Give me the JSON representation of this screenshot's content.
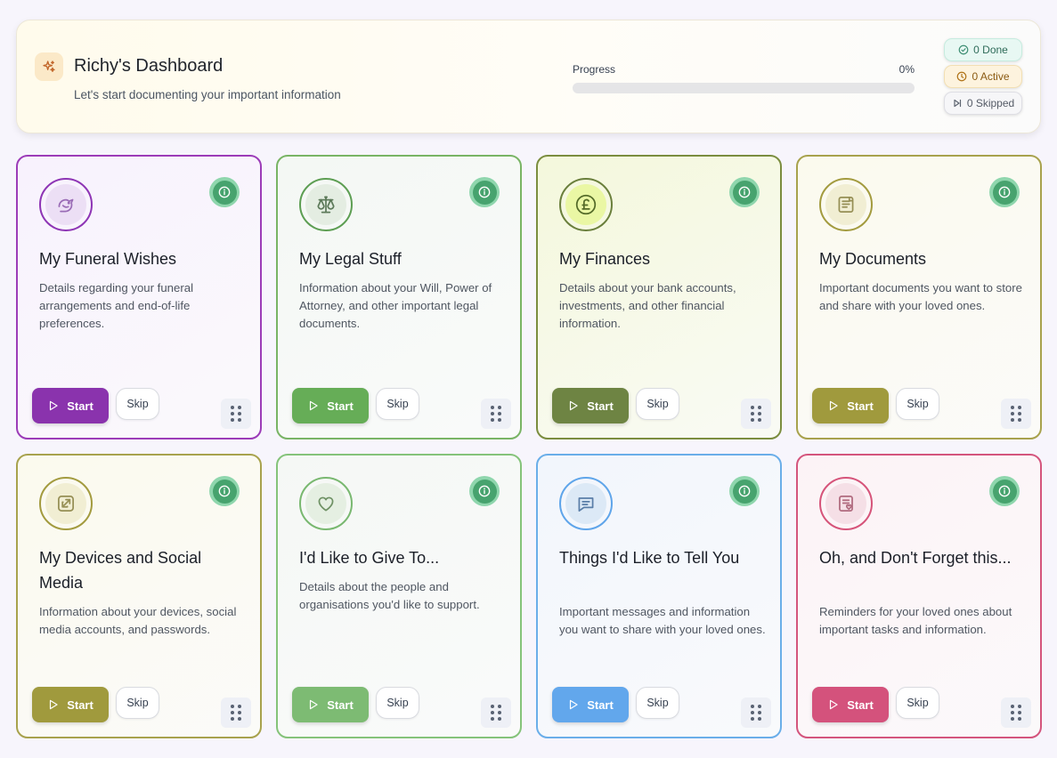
{
  "header": {
    "title": "Richy's Dashboard",
    "subtitle": "Let's start documenting your important information",
    "logo_icon": "sparkles-icon",
    "progress_label": "Progress",
    "progress_text": "0%",
    "progress_value": 0,
    "badges": {
      "done": "0 Done",
      "active": "0 Active",
      "skipped": "0 Skipped"
    }
  },
  "cards": [
    {
      "title": "My Funeral Wishes",
      "description": "Details regarding your funeral arrangements and end-of-life preferences.",
      "icon": "dove-icon",
      "start_label": "Start",
      "skip_label": "Skip",
      "accent": "#8e35b5",
      "border": "#9c3cb8",
      "bg": "#f8f2fd",
      "icon_bg": "#ecdff5",
      "icon_color": "#9a6cb6",
      "button": "#8a33ad"
    },
    {
      "title": "My Legal Stuff",
      "description": "Information about your Will, Power of Attorney, and other important legal documents.",
      "icon": "scales-icon",
      "start_label": "Start",
      "skip_label": "Skip",
      "accent": "#5d9e53",
      "border": "#79b465",
      "bg": "#f4f8f4",
      "icon_bg": "#e4ede2",
      "icon_color": "#5d7a5a",
      "button": "#66ad57"
    },
    {
      "title": "My Finances",
      "description": "Details about your bank accounts, investments, and other financial information.",
      "icon": "pound-icon",
      "start_label": "Start",
      "skip_label": "Skip",
      "accent": "#6a7f3c",
      "border": "#7b8d3f",
      "bg": "#f4f8dc",
      "icon_bg": "#eaf7a4",
      "icon_color": "#546a28",
      "button": "#6e8443"
    },
    {
      "title": "My Documents",
      "description": "Important documents you want to store and share with your loved ones.",
      "icon": "document-icon",
      "start_label": "Start",
      "skip_label": "Skip",
      "accent": "#a39b3f",
      "border": "#a8a24d",
      "bg": "#fbfaee",
      "icon_bg": "#f1eed3",
      "icon_color": "#968f55",
      "button": "#a09a3d"
    },
    {
      "title": "My Devices and Social Media",
      "description": "Information about your devices, social media accounts, and passwords.",
      "icon": "share-icon",
      "start_label": "Start",
      "skip_label": "Skip",
      "accent": "#a39b3f",
      "border": "#a8a24d",
      "bg": "#fbfaee",
      "icon_bg": "#f1eed3",
      "icon_color": "#968f55",
      "button": "#a09a3d"
    },
    {
      "title": "I'd Like to Give To...",
      "description": "Details about the people and organisations you'd like to support.",
      "icon": "heart-icon",
      "start_label": "Start",
      "skip_label": "Skip",
      "accent": "#79b870",
      "border": "#85c37a",
      "bg": "#f5f8f5",
      "icon_bg": "#e5efe2",
      "icon_color": "#6e9164",
      "button": "#7dbb73"
    },
    {
      "title": "Things I'd Like to Tell You",
      "description": "Important messages and information you want to share with your loved ones.",
      "icon": "message-icon",
      "start_label": "Start",
      "skip_label": "Skip",
      "accent": "#5fa5ea",
      "border": "#6aaee9",
      "bg": "#f2f6fc",
      "icon_bg": "#dce9f6",
      "icon_color": "#5a7ea8",
      "button": "#62a7ec"
    },
    {
      "title": "Oh, and Don't Forget this...",
      "description": "Reminders for your loved ones about important tasks and information.",
      "icon": "note-heart-icon",
      "start_label": "Start",
      "skip_label": "Skip",
      "accent": "#d6547a",
      "border": "#d4557d",
      "bg": "#fcf3f6",
      "icon_bg": "#f5dfe6",
      "icon_color": "#b06a7e",
      "button": "#d4527c"
    }
  ]
}
